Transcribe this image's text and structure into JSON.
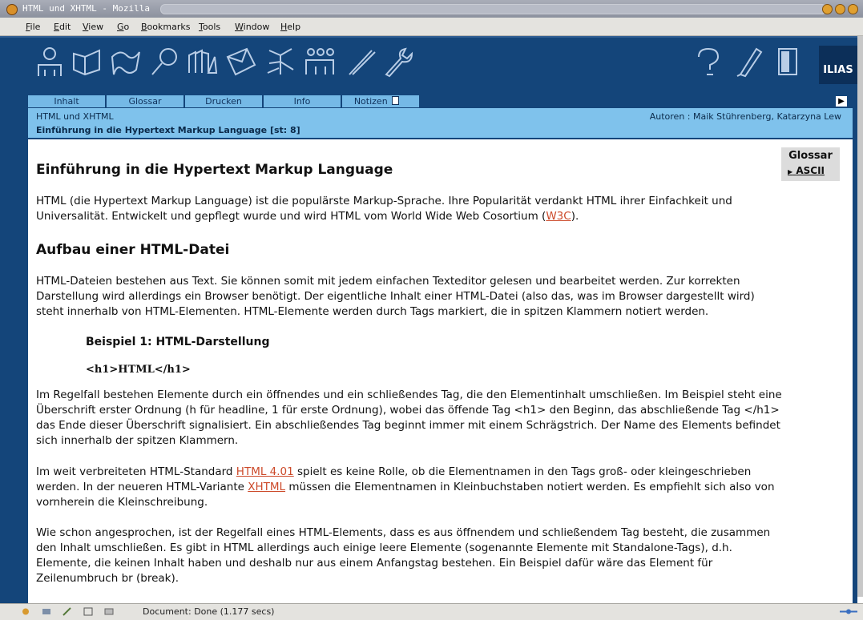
{
  "window": {
    "title": "HTML und XHTML - Mozilla"
  },
  "menu": [
    "File",
    "Edit",
    "View",
    "Go",
    "Bookmarks",
    "Tools",
    "Window",
    "Help"
  ],
  "toolbar": {
    "brand": "ILIAS"
  },
  "tabs": [
    "Inhalt",
    "Glossar",
    "Drucken",
    "Info",
    "Notizen"
  ],
  "infobar": {
    "course": "HTML und XHTML",
    "chapter": "Einführung in die Hypertext Markup Language  [st: 8]",
    "authors": "Autoren : Maik Stührenberg, Katarzyna Lew"
  },
  "glossary": {
    "title": "Glossar",
    "item": "ASCII"
  },
  "content": {
    "heading": "Einführung in die Hypertext Markup Language",
    "intro_line1": "HTML (die Hypertext Markup Language) ist die populärste Markup-Sprache. Ihre Popularität verdankt HTML ihrer Einfachkeit und",
    "intro_line2_a": "Universalität. Entwickelt und gepflegt wurde und wird HTML vom World Wide Web Cosortium (",
    "intro_link": "W3C",
    "intro_line2_b": ").",
    "section_heading": "Aufbau einer HTML-Datei",
    "p1_line1": "HTML-Dateien bestehen aus Text. Sie können somit mit jedem einfachen Texteditor gelesen und bearbeitet werden. Zur korrekten",
    "p1_line2": "Darstellung wird allerdings ein Browser benötigt. Der eigentliche Inhalt einer HTML-Datei (also das, was im Browser dargestellt wird)",
    "p1_line3": "steht innerhalb von HTML-Elementen. HTML-Elemente werden durch Tags markiert, die in spitzen Klammern notiert werden.",
    "example_title": "Beispiel 1: HTML-Darstellung",
    "example_code": "<h1>HTML</h1>",
    "p2_line1": "Im Regelfall bestehen Elemente durch ein öffnendes und ein schließendes Tag, die den Elementinhalt umschließen. Im Beispiel steht eine",
    "p2_line2": "Überschrift erster Ordnung (h für headline, 1 für erste Ordnung), wobei das öffende Tag <h1> den Beginn, das abschließende Tag </h1>",
    "p2_line3": "das Ende dieser Überschrift signalisiert. Ein abschließendes Tag beginnt immer mit einem Schrägstrich. Der Name des Elements befindet",
    "p2_line4": "sich innerhalb der spitzen Klammern.",
    "p3_line1_a": "Im weit verbreiteten HTML-Standard ",
    "p3_link1": "HTML 4.01",
    "p3_line1_b": " spielt es keine Rolle, ob die Elementnamen in den Tags groß- oder kleingeschrieben",
    "p3_line2_a": "werden. In der neueren HTML-Variante ",
    "p3_link2": "XHTML",
    "p3_line2_b": " müssen die Elementnamen in Kleinbuchstaben notiert werden. Es empfiehlt sich also von",
    "p3_line3": "vornherein die Kleinschreibung.",
    "p4_line1": "Wie schon angesprochen, ist der Regelfall eines HTML-Elements, dass es aus öffnendem und schließendem Tag besteht, die zusammen",
    "p4_line2": "den Inhalt umschließen. Es gibt in HTML allerdings auch einige leere Elemente (sogenannte Elemente mit Standalone-Tags), d.h.",
    "p4_line3": "Elemente, die keinen Inhalt haben und deshalb nur aus einem Anfangstag bestehen. Ein Beispiel dafür wäre das Element für",
    "p4_line4": "Zeilenumbruch br (break)."
  },
  "status": {
    "text": "Document: Done (1.177 secs)"
  }
}
